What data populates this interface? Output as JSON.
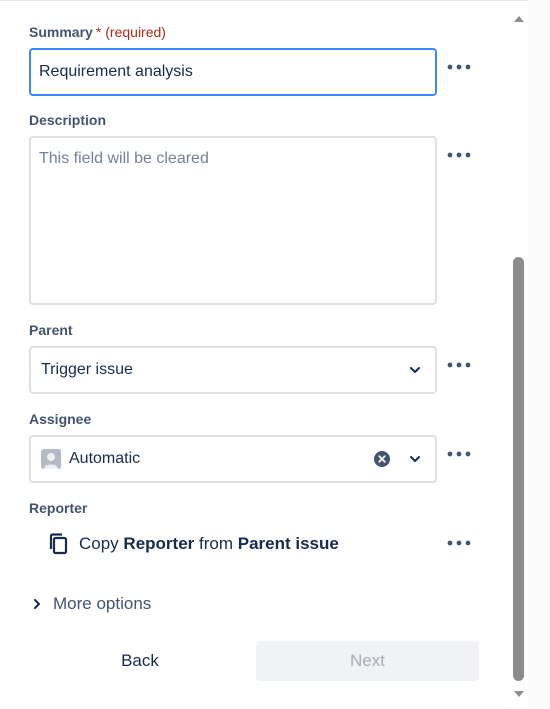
{
  "summary": {
    "label": "Summary",
    "star": "*",
    "required_text": "(required)",
    "value": "Requirement analysis"
  },
  "description": {
    "label": "Description",
    "placeholder": "This field will be cleared"
  },
  "parent": {
    "label": "Parent",
    "value": "Trigger issue"
  },
  "assignee": {
    "label": "Assignee",
    "value": "Automatic"
  },
  "reporter": {
    "label": "Reporter",
    "copy": "Copy",
    "field": "Reporter",
    "from": "from",
    "source": "Parent issue"
  },
  "more_options": "More options",
  "footer": {
    "back": "Back",
    "next": "Next"
  },
  "colors": {
    "focus_border": "#388bff",
    "required": "#ae2a19",
    "scroll_thumb": "#8c8c8c"
  },
  "icons": [
    "more-icon",
    "chevron-down-icon",
    "clear-icon",
    "avatar-icon",
    "copy-icon",
    "chevron-right-icon"
  ]
}
